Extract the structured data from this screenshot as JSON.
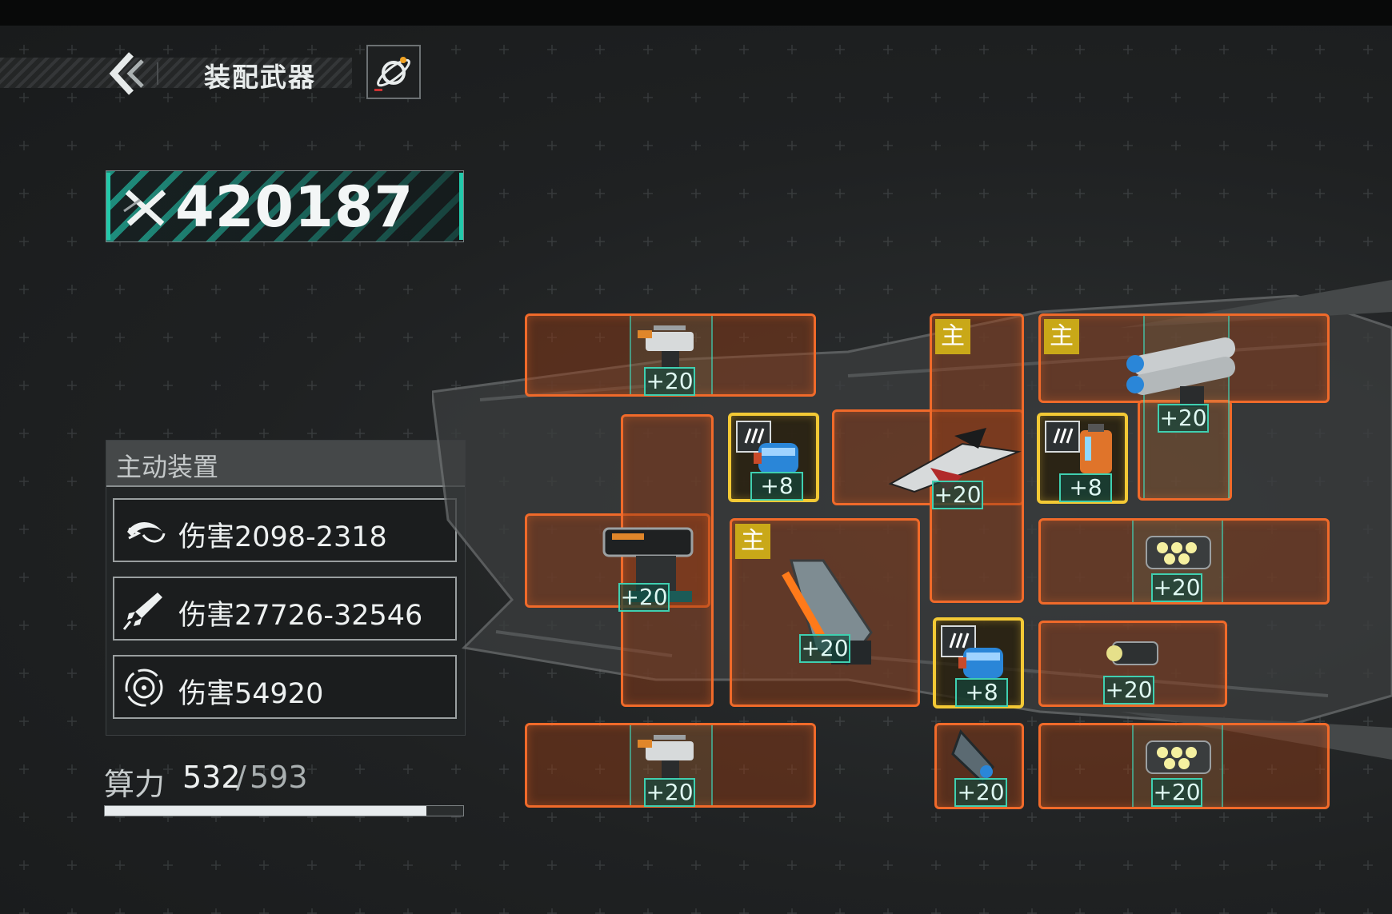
{
  "header": {
    "title": "装配武器"
  },
  "power": {
    "value": "420187"
  },
  "active_devices": {
    "title": "主动装置",
    "rows": [
      {
        "icon": "boomerang-icon",
        "text": "伤害2098-2318"
      },
      {
        "icon": "rocket-icon",
        "text": "伤害27726-32546"
      },
      {
        "icon": "target-ring-icon",
        "text": "伤害54920"
      }
    ]
  },
  "compute": {
    "label": "算力",
    "current": "532",
    "separator": "/",
    "max": "593",
    "fill_fraction": 0.897
  },
  "slots": [
    {
      "id": "top-left-turret",
      "badge": "+20",
      "main": false
    },
    {
      "id": "left-cannon",
      "badge": "+20",
      "main": false
    },
    {
      "id": "ammo-blue-1",
      "badge": "+8",
      "main": false,
      "ammo": true
    },
    {
      "id": "center-gun",
      "badge": "+20",
      "main": true,
      "main_label": "主"
    },
    {
      "id": "jet-fighter",
      "badge": "+20",
      "main": true,
      "main_label": "主"
    },
    {
      "id": "ammo-blue-2",
      "badge": "+8",
      "main": false,
      "ammo": true
    },
    {
      "id": "missile-pod",
      "badge": "+20",
      "main": false
    },
    {
      "id": "bottom-left-turret",
      "badge": "+20",
      "main": false
    },
    {
      "id": "top-right-launcher",
      "badge": "+20",
      "main": true,
      "main_label": "主"
    },
    {
      "id": "ammo-orange",
      "badge": "+8",
      "main": false,
      "ammo": true
    },
    {
      "id": "gatling-1",
      "badge": "+20",
      "main": false
    },
    {
      "id": "small-cannon",
      "badge": "+20",
      "main": false
    },
    {
      "id": "gatling-2",
      "badge": "+20",
      "main": false
    }
  ],
  "colors": {
    "slot_border": "#f06a2a",
    "ammo_border": "#f3c935",
    "badge_teal": "#3fcfb0",
    "main_tag": "#c9a818",
    "power_teal": "#22c9aa"
  }
}
